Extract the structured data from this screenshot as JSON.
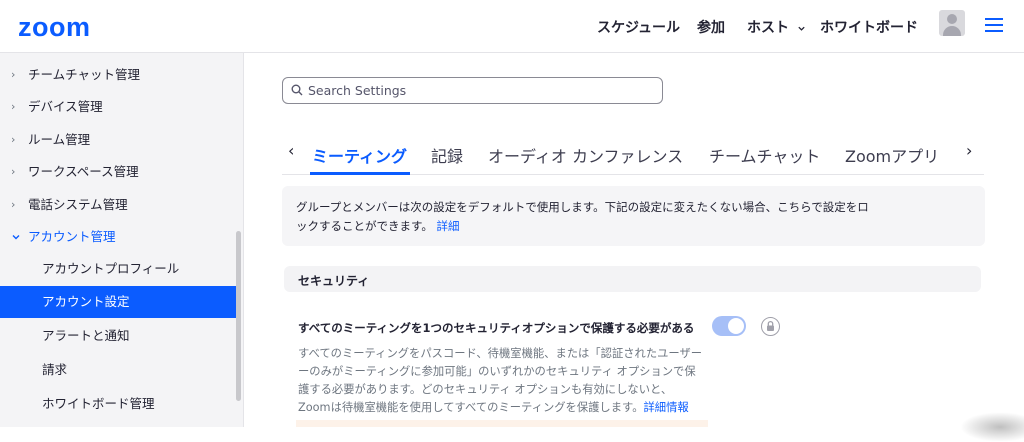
{
  "header": {
    "logo": "zoom",
    "nav": {
      "schedule": "スケジュール",
      "join": "参加",
      "host": "ホスト",
      "whiteboard": "ホワイトボード"
    }
  },
  "sidebar": {
    "items": [
      {
        "label": "チームチャット管理"
      },
      {
        "label": "デバイス管理"
      },
      {
        "label": "ルーム管理"
      },
      {
        "label": "ワークスペース管理"
      },
      {
        "label": "電話システム管理"
      },
      {
        "label": "アカウント管理"
      },
      {
        "label": "アカウントプロフィール"
      },
      {
        "label": "アカウント設定"
      },
      {
        "label": "アラートと通知"
      },
      {
        "label": "請求"
      },
      {
        "label": "ホワイトボード管理"
      }
    ]
  },
  "search": {
    "placeholder": "Search Settings"
  },
  "tabs": [
    {
      "label": "ミーティング"
    },
    {
      "label": "記録"
    },
    {
      "label": "オーディオ カンファレンス"
    },
    {
      "label": "チームチャット"
    },
    {
      "label": "Zoomアプリ"
    }
  ],
  "info": {
    "line1": "グループとメンバーは次の設定をデフォルトで使用します。下記の設定に変えたくない場合、こちらで設定をロ",
    "line2": "ックすることができます。",
    "link": "詳細"
  },
  "section": {
    "title": "セキュリティ"
  },
  "setting": {
    "title": "すべてのミーティングを1つのセキュリティオプションで保護する必要がある",
    "desc_line1": "すべてのミーティングをパスコード、待機室機能、または「認証されたユーザー",
    "desc_line2": "ーのみがミーティングに参加可能」のいずれかのセキュリティ オプションで保",
    "desc_line3": "護する必要があります。どのセキュリティ オプションも有効にしないと、",
    "desc_line4": "Zoomは待機室機能を使用してすべてのミーティングを保護します。",
    "link": "詳細情報",
    "enabled": true
  },
  "colors": {
    "accent": "#0b5cff",
    "toggle_on_disabled": "#a6bff7"
  }
}
